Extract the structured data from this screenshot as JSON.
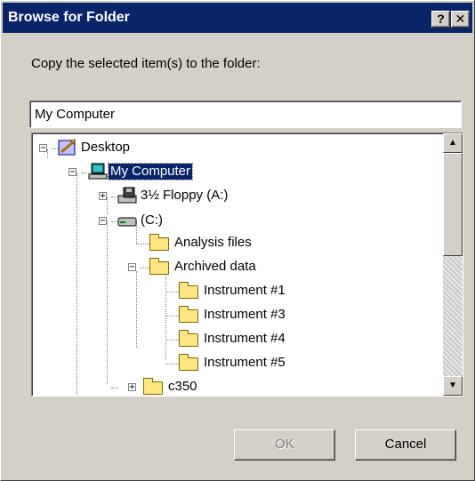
{
  "window": {
    "title": "Browse for Folder",
    "help_glyph": "?",
    "close_glyph": "✕"
  },
  "prompt": "Copy the selected item(s) to the folder:",
  "path_value": "My Computer",
  "tree": {
    "nodes": [
      {
        "label": "Desktop",
        "icon": "desktop-icon",
        "expander": "−",
        "selected": false
      },
      {
        "label": "My Computer",
        "icon": "computer-icon",
        "expander": "−",
        "selected": true
      },
      {
        "label": "3½ Floppy (A:)",
        "icon": "floppy-drive-icon",
        "expander": "+",
        "selected": false
      },
      {
        "label": "(C:)",
        "icon": "hard-drive-icon",
        "expander": "−",
        "selected": false
      },
      {
        "label": "Analysis files",
        "icon": "folder-icon",
        "expander": "",
        "selected": false
      },
      {
        "label": "Archived data",
        "icon": "folder-icon",
        "expander": "−",
        "selected": false
      },
      {
        "label": "Instrument #1",
        "icon": "folder-icon",
        "expander": "",
        "selected": false
      },
      {
        "label": "Instrument #3",
        "icon": "folder-icon",
        "expander": "",
        "selected": false
      },
      {
        "label": "Instrument #4",
        "icon": "folder-icon",
        "expander": "",
        "selected": false
      },
      {
        "label": "Instrument #5",
        "icon": "folder-icon",
        "expander": "",
        "selected": false
      },
      {
        "label": "c350",
        "icon": "folder-icon",
        "expander": "+",
        "selected": false
      }
    ]
  },
  "scrollbar": {
    "up_glyph": "▲",
    "down_glyph": "▼"
  },
  "buttons": {
    "ok": "OK",
    "cancel": "Cancel"
  }
}
